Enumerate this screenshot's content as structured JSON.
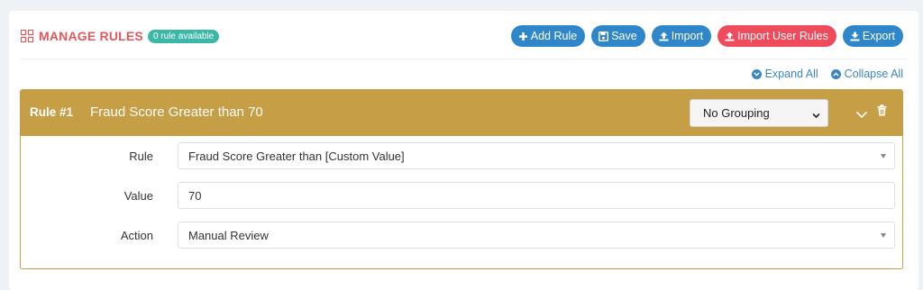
{
  "header": {
    "title": "MANAGE RULES",
    "badge": "0 rule available",
    "buttons": {
      "add_rule": "Add Rule",
      "save": "Save",
      "import": "Import",
      "import_user_rules": "Import User Rules",
      "export": "Export"
    }
  },
  "controls": {
    "expand_all": "Expand All",
    "collapse_all": "Collapse All"
  },
  "rule": {
    "number_label": "Rule #1",
    "name": "Fraud Score Greater than 70",
    "grouping_value": "No Grouping",
    "fields": {
      "rule_label": "Rule",
      "rule_value": "Fraud Score Greater than [Custom Value]",
      "value_label": "Value",
      "value_value": "70",
      "action_label": "Action",
      "action_value": "Manual Review"
    }
  },
  "colors": {
    "title": "#e0585b",
    "badge": "#3bb7a8",
    "primary": "#2f86c8",
    "danger": "#ee4b5c",
    "rule_header": "#c69e45",
    "background": "#eef1f6"
  },
  "icons": {
    "title": "grid-icon",
    "add_rule": "plus-circle-icon",
    "save": "floppy-disk-icon",
    "import": "upload-icon",
    "import_user_rules": "upload-icon",
    "export": "download-icon",
    "expand_all": "chevron-down-circle-icon",
    "collapse_all": "chevron-up-circle-icon",
    "rule_collapse": "chevron-down-icon",
    "rule_delete": "trash-icon"
  }
}
